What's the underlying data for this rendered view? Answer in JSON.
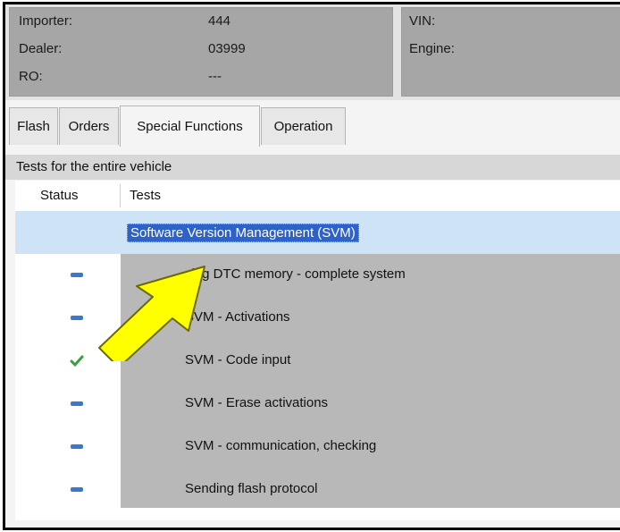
{
  "header": {
    "left": [
      {
        "label": "Importer:",
        "value": "444"
      },
      {
        "label": "Dealer:",
        "value": "03999"
      },
      {
        "label": "RO:",
        "value": "---"
      }
    ],
    "right": [
      {
        "label": "VIN:",
        "value": ""
      },
      {
        "label": "Engine:",
        "value": ""
      }
    ]
  },
  "tabs": [
    {
      "label": "Flash",
      "active": false
    },
    {
      "label": "Orders",
      "active": false
    },
    {
      "label": "Special Functions",
      "active": true
    },
    {
      "label": "Operation",
      "active": false
    }
  ],
  "section": {
    "title": "Tests for the entire vehicle"
  },
  "table": {
    "columns": {
      "status": "Status",
      "tests": "Tests"
    },
    "group": {
      "label": "Software Version Management (SVM)",
      "selected": true
    },
    "rows": [
      {
        "label": "sing DTC memory - complete system",
        "status": "pending"
      },
      {
        "label": "SVM - Activations",
        "status": "pending"
      },
      {
        "label": "SVM - Code input",
        "status": "done"
      },
      {
        "label": "SVM - Erase activations",
        "status": "pending"
      },
      {
        "label": "SVM - communication, checking",
        "status": "pending"
      },
      {
        "label": "Sending flash protocol",
        "status": "pending"
      }
    ]
  },
  "colors": {
    "pending_icon": "#3a78c9",
    "done_icon": "#3aa03a",
    "arrow_fill": "#ffff00",
    "arrow_stroke": "#6b6b00",
    "selection": "#2f62c7",
    "group_row_bg": "#cfe3f7"
  },
  "icons": {
    "pending": "blue-dash-icon",
    "done": "green-check-icon",
    "pointer": "yellow-arrow-annotation"
  }
}
